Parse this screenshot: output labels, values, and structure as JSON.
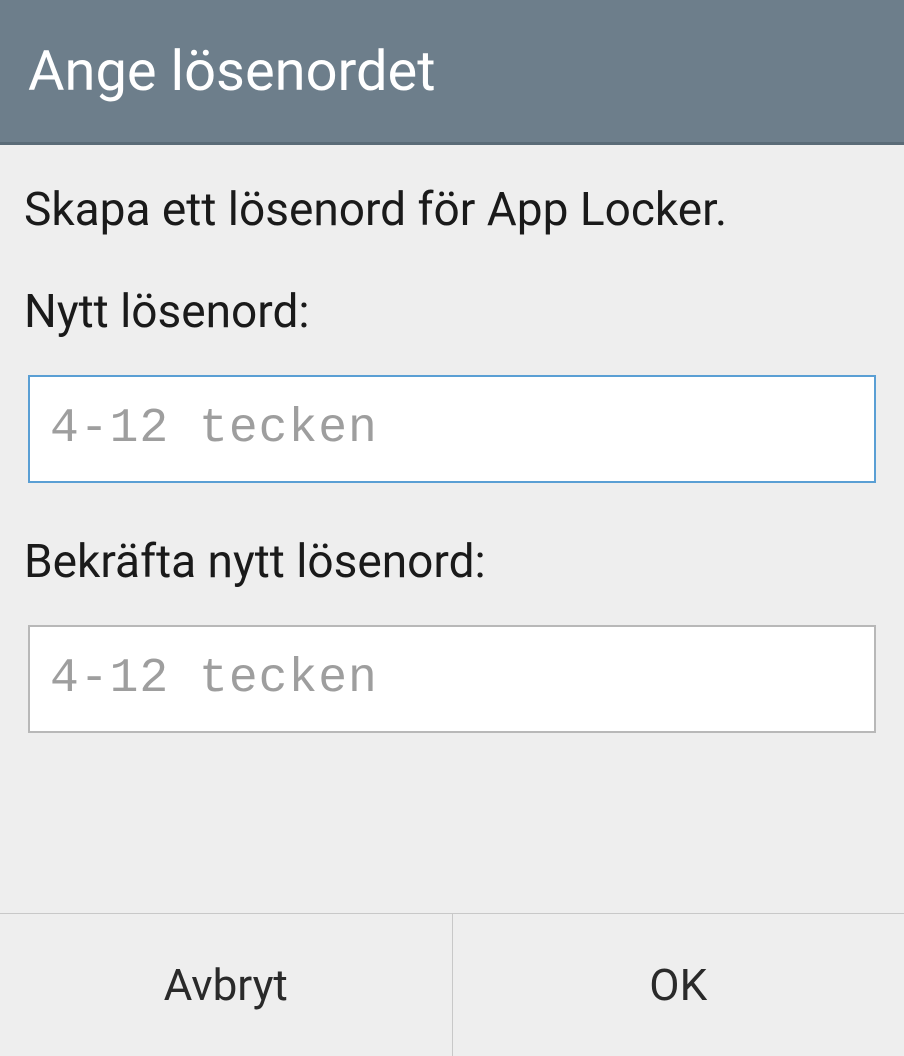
{
  "header": {
    "title": "Ange lösenordet"
  },
  "content": {
    "description": "Skapa ett lösenord för App Locker.",
    "newPassword": {
      "label": "Nytt lösenord:",
      "placeholder": "4-12 tecken",
      "value": ""
    },
    "confirmPassword": {
      "label": "Bekräfta nytt lösenord:",
      "placeholder": "4-12 tecken",
      "value": ""
    }
  },
  "buttons": {
    "cancel": "Avbryt",
    "ok": "OK"
  }
}
